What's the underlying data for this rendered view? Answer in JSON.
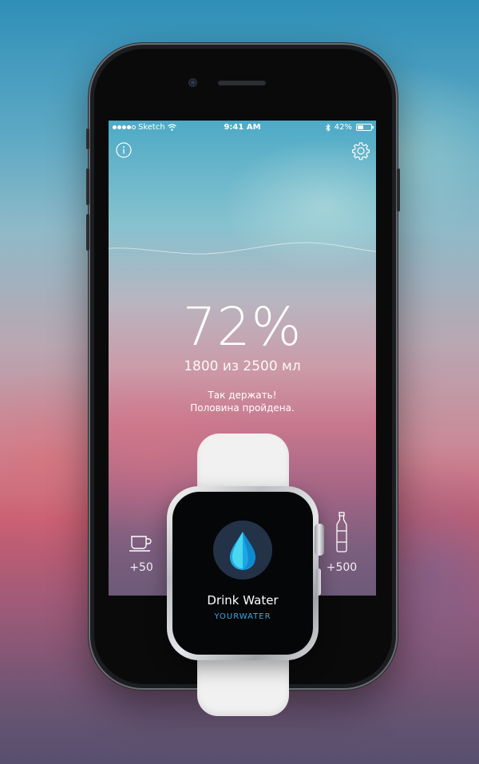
{
  "status_bar": {
    "carrier": "Sketch",
    "time": "9:41 AM",
    "battery_text": "42%",
    "battery_level": 0.42
  },
  "icons": {
    "info": "info-icon",
    "settings": "gear-icon",
    "cup": "cup-icon",
    "bottle": "bottle-icon",
    "drop": "water-drop-icon"
  },
  "main": {
    "percent": "72%",
    "progress_fraction": 0.72,
    "amount": "1800 из 2500 мл",
    "message_line1": "Так держать!",
    "message_line2": "Половина пройдена."
  },
  "quick_add": {
    "small_label": "+50",
    "large_label": "+500"
  },
  "watch": {
    "title": "Drink Water",
    "subtitle": "YOURWATER"
  },
  "colors": {
    "accent": "#3fa9e6",
    "drop_light": "#49d7ef",
    "drop_dark": "#1da6e4"
  }
}
